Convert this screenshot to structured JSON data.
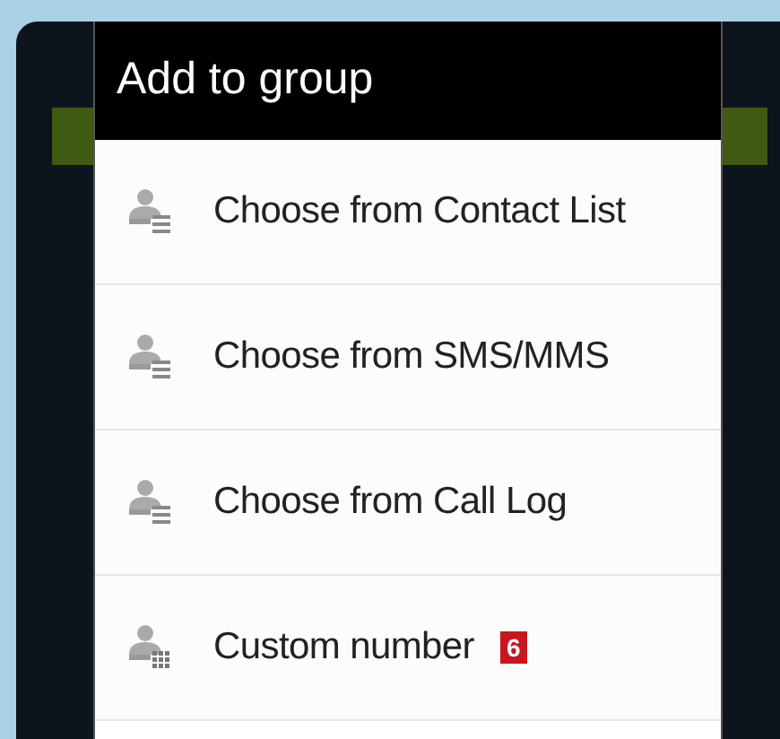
{
  "dialog": {
    "title": "Add to group",
    "items": [
      {
        "label": "Choose from Contact List",
        "kind": "list"
      },
      {
        "label": "Choose from SMS/MMS",
        "kind": "list"
      },
      {
        "label": "Choose from Call Log",
        "kind": "list"
      },
      {
        "label": "Custom number",
        "kind": "keypad",
        "callout": "6"
      }
    ]
  }
}
